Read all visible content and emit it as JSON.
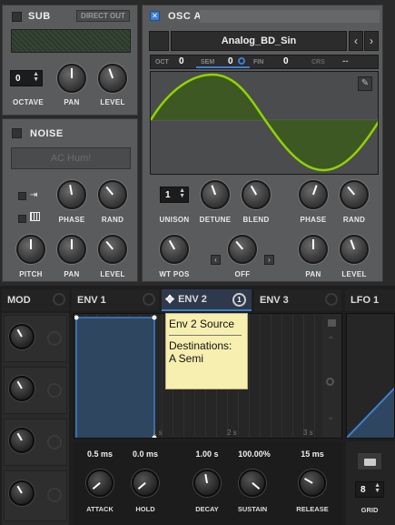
{
  "sub": {
    "title": "SUB",
    "direct_out": "DIRECT OUT",
    "octave_value": "0",
    "labels": [
      "OCTAVE",
      "PAN",
      "LEVEL"
    ]
  },
  "noise": {
    "title": "NOISE",
    "source": "AC Hum!",
    "labels": [
      "PHASE",
      "RAND",
      "PITCH",
      "PAN",
      "LEVEL"
    ]
  },
  "osc": {
    "title": "OSC A",
    "wavetable": "Analog_BD_Sin",
    "oct_label": "OCT",
    "oct_value": "0",
    "sem_label": "SEM",
    "sem_value": "0",
    "fin_label": "FIN",
    "fin_value": "0",
    "crs_label": "CRS",
    "crs_value": "--",
    "unison_value": "1",
    "labels": [
      "UNISON",
      "DETUNE",
      "BLEND",
      "PHASE",
      "RAND",
      "WT POS",
      "OFF",
      "PAN",
      "LEVEL"
    ]
  },
  "mod_tabs": {
    "mod": "MOD",
    "env1": "ENV 1",
    "env2": "ENV 2",
    "env2_badge": "1",
    "env3": "ENV 3",
    "lfo1": "LFO 1"
  },
  "tooltip": {
    "title": "Env 2 Source",
    "dest_label": "Destinations:",
    "dest_value": "A Semi"
  },
  "env_graph": {
    "ticks": [
      "1 s",
      "2 s",
      "3 s"
    ]
  },
  "envelope": {
    "attack": {
      "label": "ATTACK",
      "value": "0.5 ms"
    },
    "hold": {
      "label": "HOLD",
      "value": "0.0 ms"
    },
    "decay": {
      "label": "DECAY",
      "value": "1.00 s"
    },
    "sustain": {
      "label": "SUSTAIN",
      "value": "100.00%"
    },
    "release": {
      "label": "RELEASE",
      "value": "15 ms"
    }
  },
  "lfo": {
    "grid_value": "8",
    "grid_label": "GRID"
  },
  "colors": {
    "accent_green": "#8fd400",
    "accent_blue": "#3d7fd0",
    "tooltip_bg": "#f7efb0"
  },
  "icons": [
    "pencil-icon",
    "prev-arrow-icon",
    "next-arrow-icon",
    "move-icon",
    "lock-icon",
    "zoom-icon",
    "folder-icon"
  ]
}
